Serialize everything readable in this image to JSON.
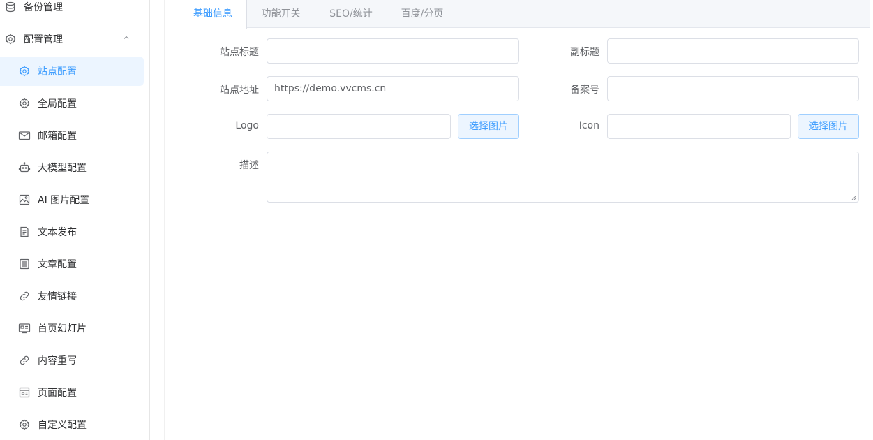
{
  "sidebar": {
    "items": [
      {
        "label": "备份管理",
        "icon": "database-icon"
      },
      {
        "label": "配置管理",
        "icon": "gear-icon"
      },
      {
        "label": "站点配置",
        "icon": "gear-icon"
      },
      {
        "label": "全局配置",
        "icon": "gear-icon"
      },
      {
        "label": "邮箱配置",
        "icon": "mail-icon"
      },
      {
        "label": "大模型配置",
        "icon": "robot-icon"
      },
      {
        "label": "AI 图片配置",
        "icon": "image-icon"
      },
      {
        "label": "文本发布",
        "icon": "document-icon"
      },
      {
        "label": "文章配置",
        "icon": "article-icon"
      },
      {
        "label": "友情链接",
        "icon": "link-icon"
      },
      {
        "label": "首页幻灯片",
        "icon": "slides-icon"
      },
      {
        "label": "内容重写",
        "icon": "link-icon"
      },
      {
        "label": "页面配置",
        "icon": "page-icon"
      },
      {
        "label": "自定义配置",
        "icon": "gear-icon"
      }
    ],
    "active_item": "站点配置"
  },
  "tabs": [
    {
      "label": "基础信息"
    },
    {
      "label": "功能开关"
    },
    {
      "label": "SEO/统计"
    },
    {
      "label": "百度/分页"
    }
  ],
  "form": {
    "site_title_label": "站点标题",
    "site_title_value": "",
    "subtitle_label": "副标题",
    "subtitle_value": "",
    "site_url_label": "站点地址",
    "site_url_value": "https://demo.vvcms.cn",
    "icp_label": "备案号",
    "icp_value": "",
    "logo_label": "Logo",
    "logo_value": "",
    "logo_button": "选择图片",
    "icon_label": "Icon",
    "icon_value": "",
    "icon_button": "选择图片",
    "description_label": "描述",
    "description_value": ""
  },
  "colors": {
    "accent": "#409eff",
    "active_bg": "#ecf5ff",
    "border": "#dcdfe6"
  }
}
